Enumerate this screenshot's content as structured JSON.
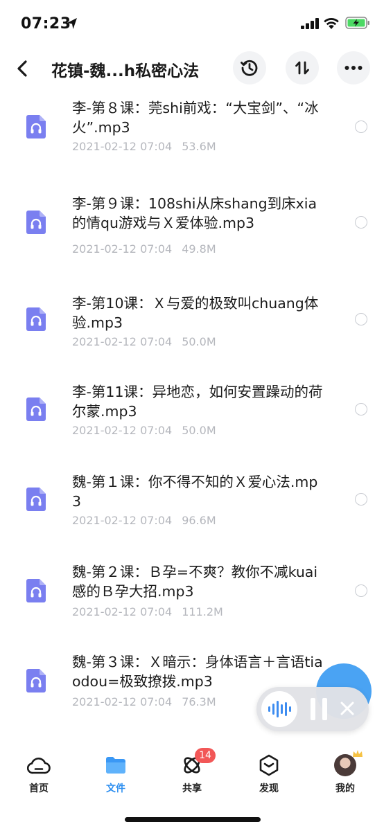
{
  "status_bar": {
    "time": "07:23"
  },
  "nav": {
    "title": "花镇-魏...h私密心法"
  },
  "files": [
    {
      "name": "李-第８课：莞shi前戏：“大宝剑”、“冰火”.mp3",
      "date": "2021-02-12 07:04",
      "size": "53.6M"
    },
    {
      "name": "李-第９课：108shi从床shang到床xia的情qu游戏与Ｘ爱体验.mp3",
      "date": "2021-02-12 07:04",
      "size": "49.8M"
    },
    {
      "name": "李-第10课：Ｘ与爱的极致叫chuang体验.mp3",
      "date": "2021-02-12 07:04",
      "size": "50.0M"
    },
    {
      "name": "李-第11课：异地恋，如何安置躁动的荷尔蒙.mp3",
      "date": "2021-02-12 07:04",
      "size": "50.0M"
    },
    {
      "name": "魏-第１课：你不得不知的Ｘ爱心法.mp3",
      "date": "2021-02-12 07:04",
      "size": "96.6M"
    },
    {
      "name": "魏-第２课：Ｂ孕=不爽？教你不减kuai感的Ｂ孕大招.mp3",
      "date": "2021-02-12 07:04",
      "size": "111.2M"
    },
    {
      "name": "魏-第３课：Ｘ暗示：身体语言＋言语tiaodou=极致撩拨.mp3",
      "date": "2021-02-12 07:04",
      "size": "76.3M"
    }
  ],
  "tabs": [
    {
      "label": "首页",
      "icon": "cloud-home-icon"
    },
    {
      "label": "文件",
      "icon": "folder-icon",
      "active": true
    },
    {
      "label": "共享",
      "icon": "share-orbit-icon",
      "badge": "14"
    },
    {
      "label": "发现",
      "icon": "discover-cube-icon"
    },
    {
      "label": "我的",
      "icon": "avatar"
    }
  ],
  "colors": {
    "accent": "#2e8ff0",
    "file_icon": "#7a7ff0",
    "badge": "#f25757",
    "meta_text": "#b5b7bd"
  }
}
